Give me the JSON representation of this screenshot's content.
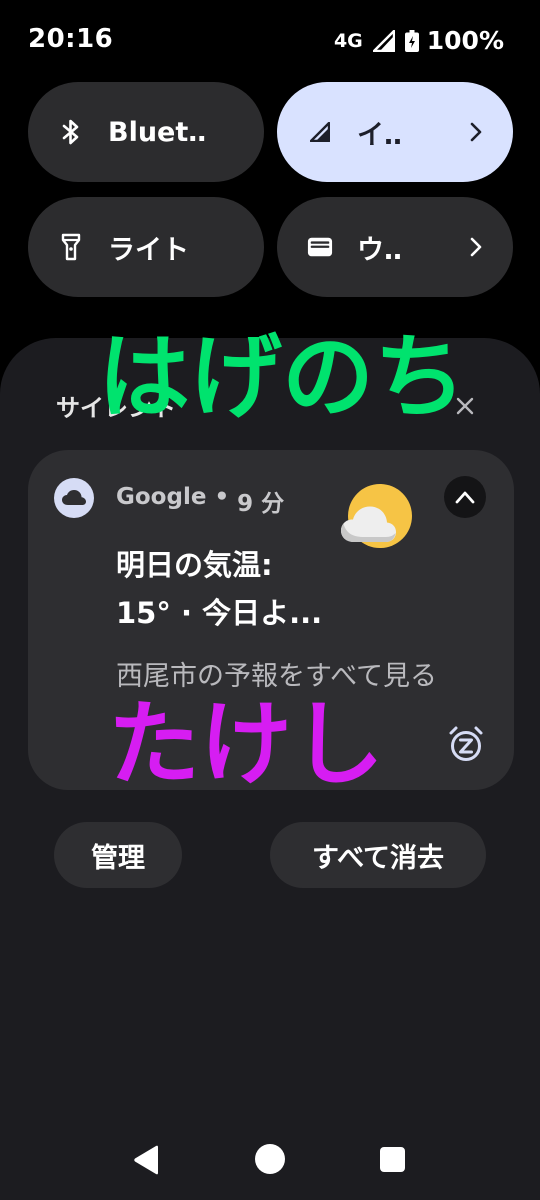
{
  "status_bar": {
    "time": "20:16",
    "network": "4G",
    "battery": "100%"
  },
  "quick_settings": {
    "tiles": [
      {
        "label": "Bluet‥",
        "icon": "bluetooth-icon",
        "active": false
      },
      {
        "label": "イ‥",
        "icon": "signal-icon",
        "active": true
      },
      {
        "label": "ライト",
        "icon": "flashlight-icon",
        "active": false
      },
      {
        "label": "ウ‥",
        "icon": "wallet-icon",
        "active": false
      }
    ]
  },
  "notifications": {
    "section_title": "サイレント",
    "card": {
      "app_name": "Google",
      "separator": "•",
      "time_ago": "9 分",
      "title_line1": "明日の気温:",
      "title_line2": "15° · 今日よ...",
      "body": "西尾市の予報をすべて見る"
    },
    "manage_label": "管理",
    "clear_all_label": "すべて消去"
  },
  "overlays": {
    "green_text": "はげのち",
    "magenta_text": "たけし"
  },
  "colors": {
    "background": "#000000",
    "shade": "#1c1c20",
    "card": "#2e2e31",
    "tile": "#2c2c2e",
    "tile_active": "#d9e2ff",
    "overlay_green": "#00e36e",
    "overlay_magenta": "#d61df2"
  }
}
